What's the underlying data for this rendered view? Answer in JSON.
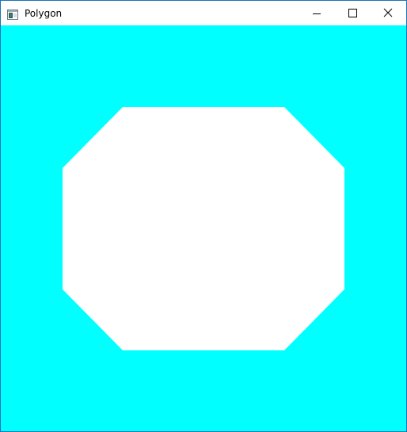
{
  "window": {
    "title": "Polygon",
    "icon": "app-window-icon",
    "controls": {
      "minimize_icon": "minimize-icon",
      "maximize_icon": "maximize-icon",
      "close_icon": "close-icon"
    }
  },
  "canvas": {
    "background_color": "#00ffff",
    "shape": {
      "type": "octagon",
      "fill_color": "#ffffff"
    }
  }
}
